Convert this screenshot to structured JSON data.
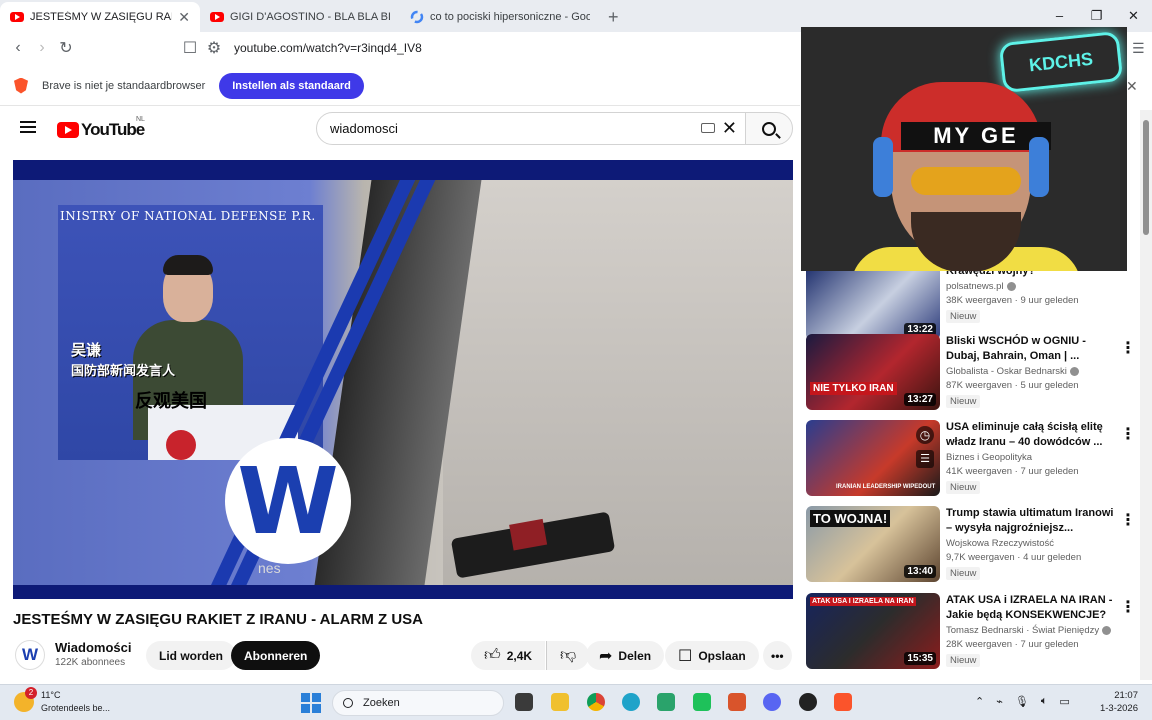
{
  "tabs": [
    {
      "title": "JESTEŚMY W ZASIĘGU RAKIET Z",
      "icon": "youtube-icon",
      "active": true
    },
    {
      "title": "GIGI D'AGOSTINO - BLA BLA BLA ( O",
      "icon": "youtube-icon",
      "active": false
    },
    {
      "title": "co to pociski hipersoniczne - Google",
      "icon": "google-icon",
      "active": false
    }
  ],
  "new_tab": "+",
  "window_controls": [
    "–",
    "❐",
    "✕"
  ],
  "address": {
    "url": "youtube.com/watch?v=r3inqd4_IV8"
  },
  "notice": {
    "text": "Brave is niet je standaardbrowser",
    "button": "Instellen als standaard"
  },
  "youtube": {
    "logo": "YouTube",
    "country": "NL",
    "search_value": "wiadomosci"
  },
  "player": {
    "header": "INISTRY OF NATIONAL DEFENSE P.R.",
    "caption_name": "吴谦",
    "caption_role": "国防部新闻发言人",
    "caption_text": "反观美国",
    "logo": "W",
    "watermark": "nes"
  },
  "video": {
    "title": "JESTEŚMY W ZASIĘGU RAKIET Z IRANU - ALARM Z USA",
    "channel": "Wiadomości",
    "subscribers": "122K abonnees",
    "join": "Lid worden",
    "subscribe": "Abonneren",
    "likes": "2,4K",
    "share": "Delen",
    "save": "Opslaan",
    "more": "•••"
  },
  "sidebar": [
    {
      "title": "Krawędzi wojny?",
      "channel": "polsatnews.pl",
      "verified": true,
      "views": "38K weergaven",
      "age": "9 uur geleden",
      "badge": "Nieuw",
      "duration": "13:22",
      "thumb_text": ""
    },
    {
      "title": "Bliski WSCHÓD w OGNIU - Dubaj, Bahrain, Oman | ...",
      "channel": "Globalista - Oskar Bednarski",
      "verified": true,
      "views": "87K weergaven",
      "age": "5 uur geleden",
      "badge": "Nieuw",
      "duration": "13:27",
      "thumb_text": "NIE TYLKO IRAN"
    },
    {
      "title": "USA eliminuje całą ścisłą elitę władz Iranu – 40 dowódców ...",
      "channel": "Biznes i Geopolityka",
      "verified": false,
      "views": "41K weergaven",
      "age": "7 uur geleden",
      "badge": "Nieuw",
      "duration": "",
      "thumb_text": "IRANIAN LEADERSHIP WIPEDOUT"
    },
    {
      "title": "Trump stawia ultimatum Iranowi – wysyła najgroźniejsz...",
      "channel": "Wojskowa Rzeczywistość",
      "verified": false,
      "views": "9,7K weergaven",
      "age": "4 uur geleden",
      "badge": "Nieuw",
      "duration": "13:40",
      "thumb_text": "TO WOJNA!"
    },
    {
      "title": "ATAK USA i IZRAELA NA IRAN - Jakie będą KONSEKWENCJE?",
      "channel": "Tomasz Bednarski · Świat Pieniędzy",
      "verified": true,
      "views": "28K weergaven",
      "age": "7 uur geleden",
      "badge": "Nieuw",
      "duration": "15:35",
      "thumb_text": "ATAK USA I IZRAELA NA IRAN"
    }
  ],
  "webcam": {
    "band_text": "MY GE",
    "neon_text": "KDCHS"
  },
  "taskbar": {
    "weather_temp": "11°C",
    "weather_desc": "Grotendeels be...",
    "weather_badge": "2",
    "search_label": "Zoeken",
    "time": "21:07",
    "date": "1-3-2026"
  },
  "colors": {
    "youtube_red": "#ff0000",
    "brave_button": "#3f39e8",
    "player_frame": "#0d1a77"
  }
}
